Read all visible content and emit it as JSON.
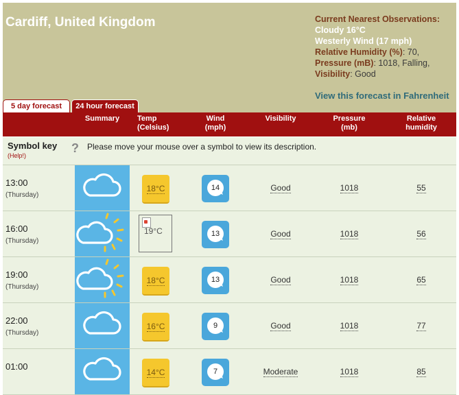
{
  "location": "Cardiff, United Kingdom",
  "observations": {
    "heading": "Current Nearest Observations:",
    "condition": "Cloudy 16°C",
    "wind": "Westerly Wind (17 mph)",
    "humidity_label": "Relative Humidity (%)",
    "humidity_value": ": 70,",
    "pressure_label": "Pressure (mB)",
    "pressure_value": ": 1018, Falling,",
    "visibility_label": "Visibility",
    "visibility_value": ": Good",
    "fahrenheit_link": "View this forecast in Fahrenheit"
  },
  "tabs": [
    {
      "label": "5 day forecast"
    },
    {
      "label": "24 hour forecast"
    }
  ],
  "columns": {
    "summary": "Summary",
    "temp": "Temp\n(Celsius)",
    "wind": "Wind\n(mph)",
    "visibility": "Visibility",
    "pressure": "Pressure\n(mb)",
    "humidity": "Relative\nhumidity"
  },
  "symbol_key": {
    "label": "Symbol key",
    "help": "(Help!)",
    "icon": "?",
    "description": "Please move your mouse over a symbol to view its description."
  },
  "rows": [
    {
      "time": "13:00",
      "day": "(Thursday)",
      "summary_icon": "cloud-icon",
      "temp": "18°C",
      "wind": "14",
      "visibility": "Good",
      "pressure": "1018",
      "humidity": "55"
    },
    {
      "time": "16:00",
      "day": "(Thursday)",
      "summary_icon": "sun-cloud-icon",
      "temp": "19°C",
      "temp_broken": true,
      "wind": "13",
      "visibility": "Good",
      "pressure": "1018",
      "humidity": "56"
    },
    {
      "time": "19:00",
      "day": "(Thursday)",
      "summary_icon": "sun-cloud-icon",
      "temp": "18°C",
      "wind": "13",
      "visibility": "Good",
      "pressure": "1018",
      "humidity": "65"
    },
    {
      "time": "22:00",
      "day": "(Thursday)",
      "summary_icon": "cloud-icon",
      "temp": "16°C",
      "wind": "9",
      "visibility": "Good",
      "pressure": "1018",
      "humidity": "77"
    },
    {
      "time": "01:00",
      "day": "",
      "summary_icon": "cloud-icon",
      "temp": "14°C",
      "wind": "7",
      "visibility": "Moderate",
      "pressure": "1018",
      "humidity": "85"
    }
  ],
  "colors": {
    "header_bg": "#c8c59a",
    "accent": "#a01010",
    "row_bg": "#ecf2e2",
    "summary_bg": "#5ab5e5",
    "temp_bg": "#f5c72d",
    "wind_bg": "#4aa7db"
  }
}
